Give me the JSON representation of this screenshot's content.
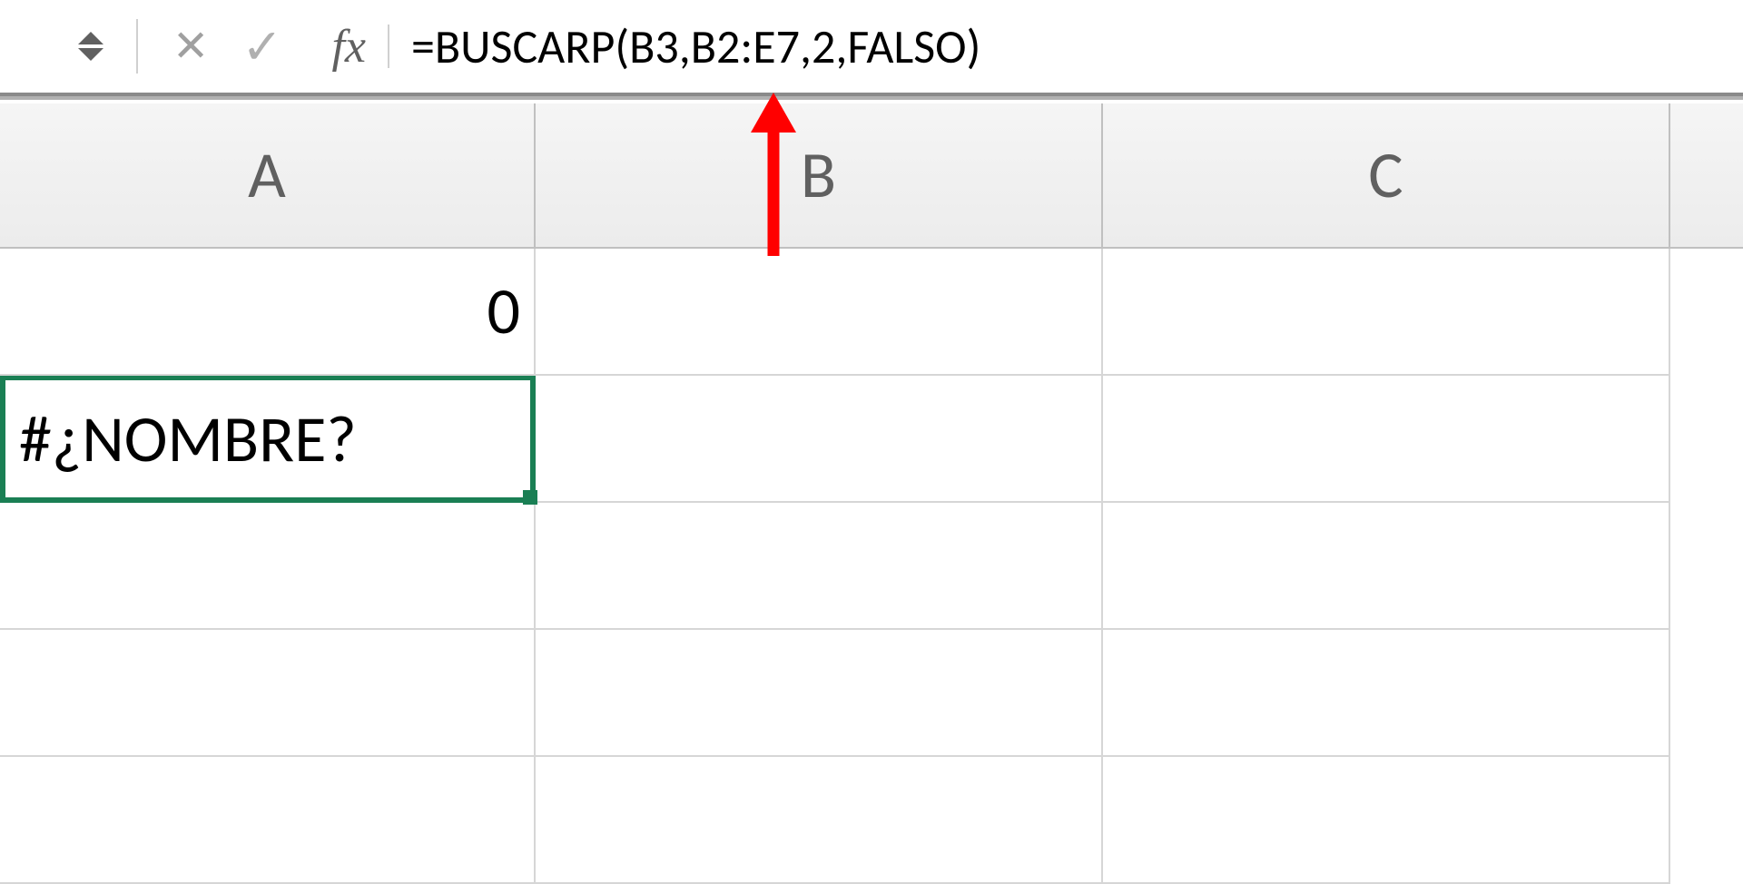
{
  "formula_bar": {
    "formula": "=BUSCARP(B3,B2:E7,2,FALSO)",
    "fx_label": "fx"
  },
  "columns": [
    "A",
    "B",
    "C"
  ],
  "cells": {
    "a1": "0",
    "a2": "#¿NOMBRE?",
    "b1": "",
    "b2": "",
    "c1": "",
    "c2": ""
  },
  "colors": {
    "selection_border": "#1a7f54",
    "annotation_arrow": "#ff0000"
  }
}
